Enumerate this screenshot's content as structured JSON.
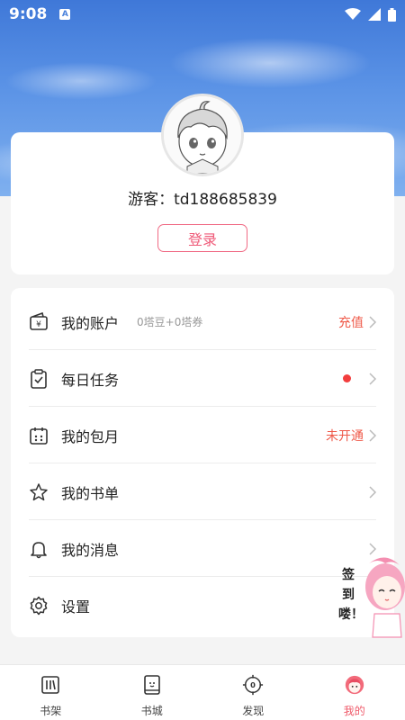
{
  "status_bar": {
    "time": "9:08",
    "notification_letter": "A"
  },
  "profile": {
    "username": "游客：td188685839",
    "login_label": "登录"
  },
  "menu": {
    "items": [
      {
        "label": "我的账户",
        "sub": "0塔豆+0塔券",
        "right": "充值",
        "icon": "wallet-icon"
      },
      {
        "label": "每日任务",
        "sub": "",
        "right": "",
        "icon": "task-clipboard-icon",
        "badge": "red-dot"
      },
      {
        "label": "我的包月",
        "sub": "",
        "right": "未开通",
        "icon": "calendar-icon"
      },
      {
        "label": "我的书单",
        "sub": "",
        "right": "",
        "icon": "star-icon"
      },
      {
        "label": "我的消息",
        "sub": "",
        "right": "",
        "icon": "bell-icon"
      },
      {
        "label": "设置",
        "sub": "",
        "right": "",
        "icon": "gear-icon"
      }
    ]
  },
  "mascot": {
    "text": "签到喽！"
  },
  "tabs": [
    {
      "label": "书架",
      "icon": "bookshelf-icon",
      "active": false
    },
    {
      "label": "书城",
      "icon": "bookstore-icon",
      "active": false
    },
    {
      "label": "发现",
      "icon": "discover-compass-icon",
      "active": false,
      "icon_text": "0"
    },
    {
      "label": "我的",
      "icon": "my-avatar-icon",
      "active": true
    }
  ],
  "colors": {
    "accent": "#ef5a78",
    "orange_text": "#ef5a4a",
    "red_dot": "#f23d3d",
    "sky_blue": "#4a82dc"
  }
}
